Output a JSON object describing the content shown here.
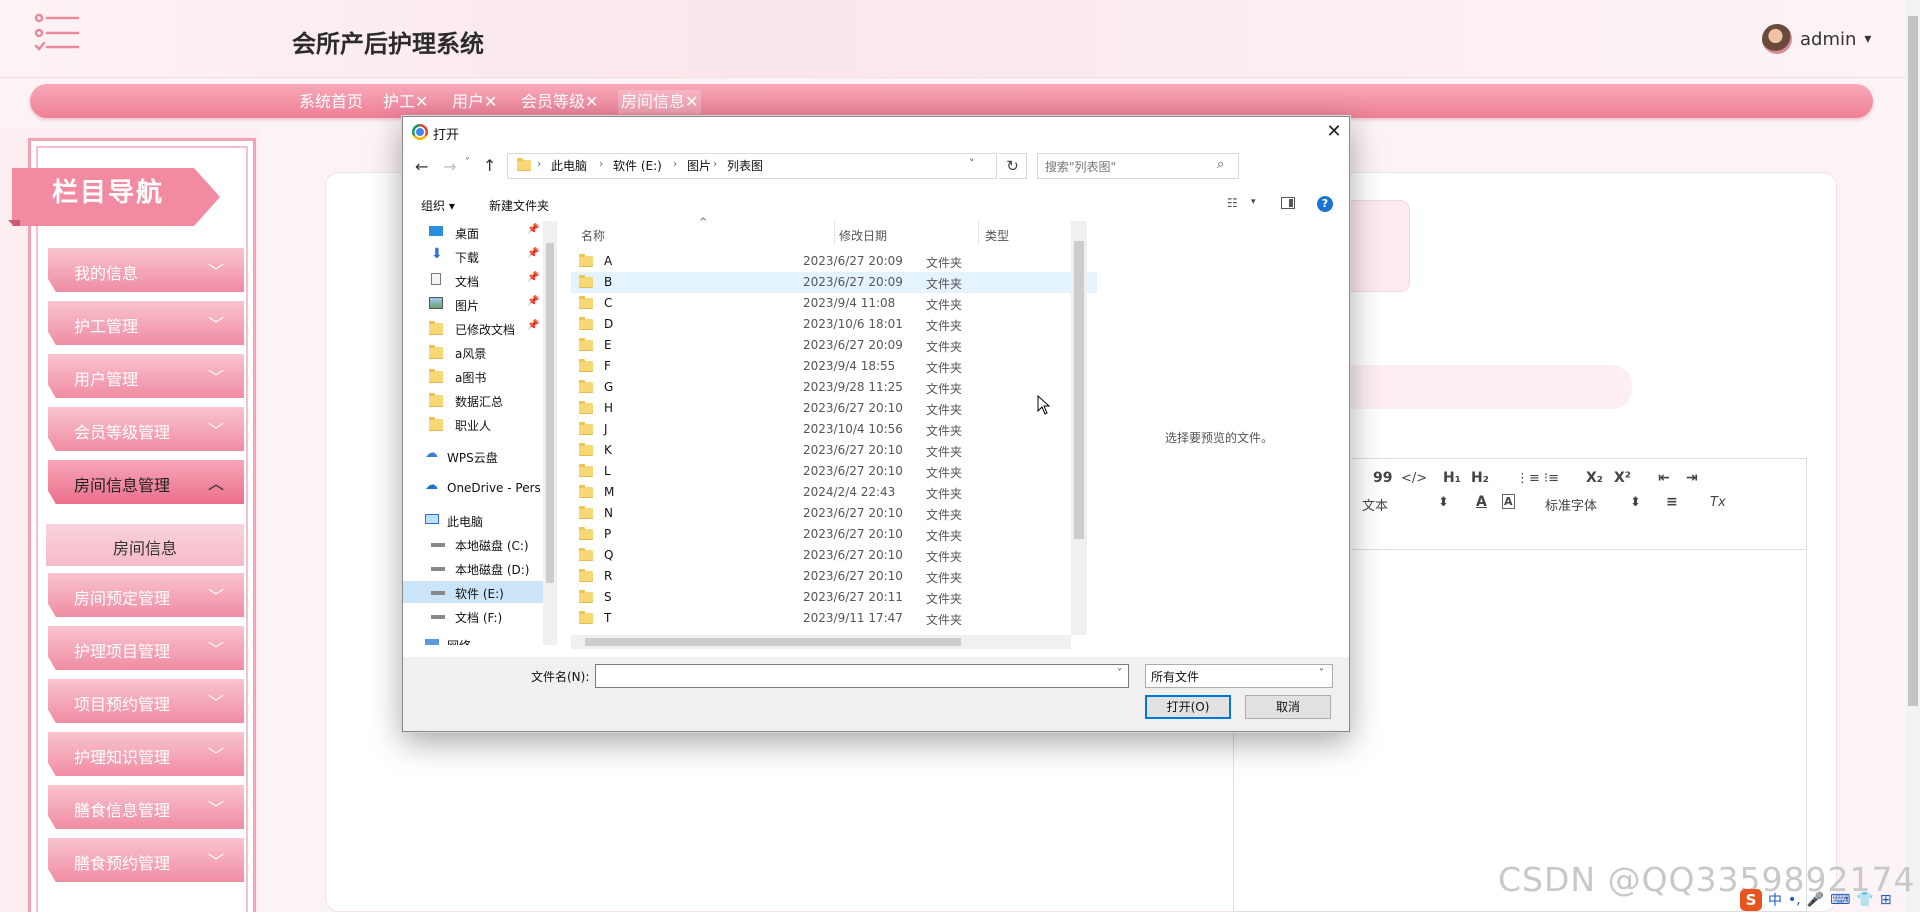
{
  "app": {
    "title": "会所产后护理系统",
    "user": "admin",
    "user_caret": "▾"
  },
  "tabs": [
    {
      "label": "系统首页",
      "active": false
    },
    {
      "label": "护工✕",
      "active": false
    },
    {
      "label": "用户✕",
      "active": false
    },
    {
      "label": "会员等级✕",
      "active": false
    },
    {
      "label": "房间信息✕",
      "active": true
    }
  ],
  "sidebar": {
    "title": "栏目导航",
    "items": [
      {
        "label": "我的信息",
        "caret": "﹀"
      },
      {
        "label": "护工管理",
        "caret": "﹀"
      },
      {
        "label": "用户管理",
        "caret": "﹀"
      },
      {
        "label": "会员等级管理",
        "caret": "﹀"
      },
      {
        "label": "房间信息管理",
        "caret": "︿"
      },
      {
        "label": "房间预定管理",
        "caret": "﹀"
      },
      {
        "label": "护理项目管理",
        "caret": "﹀"
      },
      {
        "label": "项目预约管理",
        "caret": "﹀"
      },
      {
        "label": "护理知识管理",
        "caret": "﹀"
      },
      {
        "label": "膳食信息管理",
        "caret": "﹀"
      },
      {
        "label": "膳食预约管理",
        "caret": "﹀"
      }
    ],
    "sub_item": "房间信息"
  },
  "editor": {
    "toolbar": {
      "quote": "99",
      "code": "</>",
      "h1": "H₁",
      "h2": "H₂",
      "ol": "⋮≡",
      "ul": "⁝≡",
      "sub": "X₂",
      "sup": "X²",
      "outdent": "⇤",
      "indent": "⇥",
      "size": "文本",
      "size_arrow": "⬍",
      "font_color": "A",
      "bg_color": "A",
      "font": "标准字体",
      "font_arrow": "⬍",
      "align": "≡",
      "clean": "Tx"
    }
  },
  "watermark": "CSDN @QQ3359892174",
  "ime": {
    "s": "S",
    "lang": "中",
    "punct": "•,",
    "mic": "🎤",
    "kbd": "⌨",
    "shirt": "👕",
    "grid": "⊞"
  },
  "dialog": {
    "title": "打开",
    "close": "✕",
    "nav": {
      "back": "←",
      "forward": "→",
      "recent": "˅",
      "up": "↑",
      "refresh": "↻",
      "addr_drop": "˅"
    },
    "breadcrumb": [
      "此电脑",
      "软件 (E:)",
      "图片",
      "列表图"
    ],
    "crumb_sep": "›",
    "search_placeholder": "搜索\"列表图\"",
    "search_glyph": "⌕",
    "organize": "组织 ▾",
    "new_folder": "新建文件夹",
    "view_glyph": "☷",
    "view_drop": "▾",
    "help": "?",
    "tree": [
      {
        "label": "桌面",
        "icon": "desktop-icon",
        "pinned": true
      },
      {
        "label": "下载",
        "icon": "download-icon",
        "pinned": true
      },
      {
        "label": "文档",
        "icon": "document-icon",
        "pinned": true
      },
      {
        "label": "图片",
        "icon": "pictures-icon",
        "pinned": true
      },
      {
        "label": "已修改文档",
        "icon": "folder-icon",
        "pinned": true
      },
      {
        "label": "a风景",
        "icon": "folder-icon",
        "pinned": false
      },
      {
        "label": "a图书",
        "icon": "folder-icon",
        "pinned": false
      },
      {
        "label": "数据汇总",
        "icon": "folder-icon",
        "pinned": false
      },
      {
        "label": "职业人",
        "icon": "folder-icon",
        "pinned": false
      },
      {
        "label": "WPS云盘",
        "icon": "cloud-icon",
        "pinned": false
      },
      {
        "label": "OneDrive - Pers",
        "icon": "onedrive-icon",
        "pinned": false
      },
      {
        "label": "此电脑",
        "icon": "computer-icon",
        "pinned": false
      },
      {
        "label": "本地磁盘 (C:)",
        "icon": "drive-icon",
        "pinned": false
      },
      {
        "label": "本地磁盘 (D:)",
        "icon": "drive-icon",
        "pinned": false
      },
      {
        "label": "软件 (E:)",
        "icon": "drive-icon",
        "pinned": false,
        "selected": true
      },
      {
        "label": "文档 (F:)",
        "icon": "drive-icon",
        "pinned": false
      },
      {
        "label": "网络",
        "icon": "network-icon",
        "pinned": false
      }
    ],
    "pin_glyph": "📌",
    "columns": {
      "name": "名称",
      "date": "修改日期",
      "type": "类型",
      "sort_glyph": "^"
    },
    "files": [
      {
        "name": "A",
        "date": "2023/6/27 20:09",
        "type": "文件夹"
      },
      {
        "name": "B",
        "date": "2023/6/27 20:09",
        "type": "文件夹"
      },
      {
        "name": "C",
        "date": "2023/9/4 11:08",
        "type": "文件夹"
      },
      {
        "name": "D",
        "date": "2023/10/6 18:01",
        "type": "文件夹"
      },
      {
        "name": "E",
        "date": "2023/6/27 20:09",
        "type": "文件夹"
      },
      {
        "name": "F",
        "date": "2023/9/4 18:55",
        "type": "文件夹"
      },
      {
        "name": "G",
        "date": "2023/9/28 11:25",
        "type": "文件夹"
      },
      {
        "name": "H",
        "date": "2023/6/27 20:10",
        "type": "文件夹"
      },
      {
        "name": "J",
        "date": "2023/10/4 10:56",
        "type": "文件夹"
      },
      {
        "name": "K",
        "date": "2023/6/27 20:10",
        "type": "文件夹"
      },
      {
        "name": "L",
        "date": "2023/6/27 20:10",
        "type": "文件夹"
      },
      {
        "name": "M",
        "date": "2024/2/4 22:43",
        "type": "文件夹"
      },
      {
        "name": "N",
        "date": "2023/6/27 20:10",
        "type": "文件夹"
      },
      {
        "name": "P",
        "date": "2023/6/27 20:10",
        "type": "文件夹"
      },
      {
        "name": "Q",
        "date": "2023/6/27 20:10",
        "type": "文件夹"
      },
      {
        "name": "R",
        "date": "2023/6/27 20:10",
        "type": "文件夹"
      },
      {
        "name": "S",
        "date": "2023/6/27 20:11",
        "type": "文件夹"
      },
      {
        "name": "T",
        "date": "2023/9/11 17:47",
        "type": "文件夹"
      }
    ],
    "hovered_file": "B",
    "preview_text": "选择要预览的文件。",
    "filename_label": "文件名(N):",
    "filename_value": "",
    "filetype": "所有文件",
    "drop_glyph": "˅",
    "open_button": "打开(O)",
    "cancel_button": "取消"
  },
  "colors": {
    "accent": "#ee7f97",
    "brand_pink": "#f4a6b7",
    "dialog_select": "#cce4f7",
    "win_blue": "#0078d7"
  }
}
